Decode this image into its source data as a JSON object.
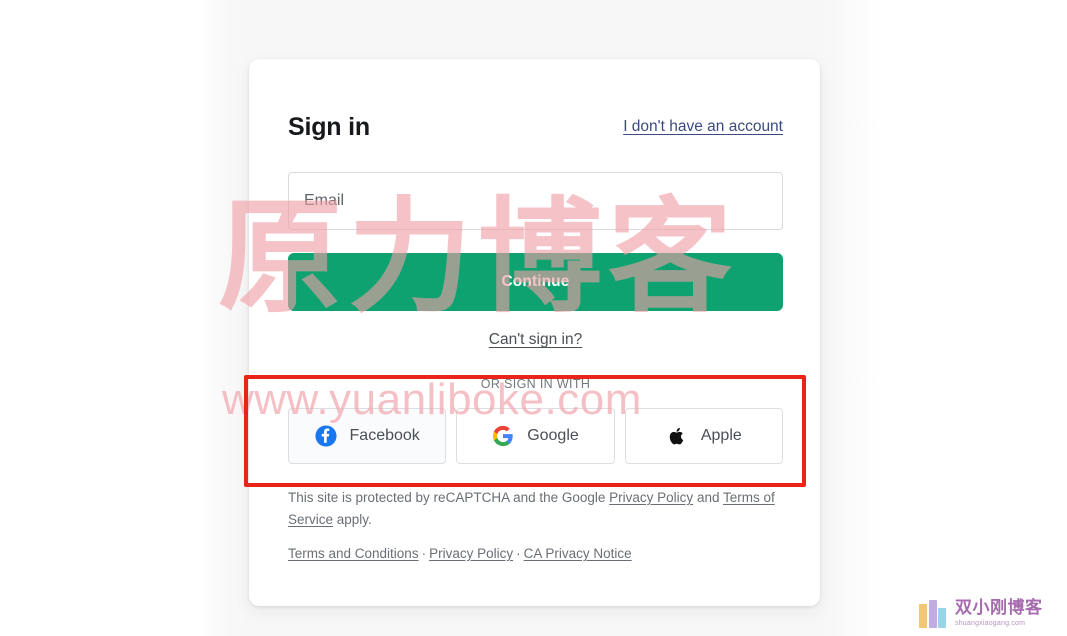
{
  "page": {
    "background_color": "#f7f7f8",
    "card_background": "#ffffff"
  },
  "card": {
    "title": "Sign in",
    "signup_link": "I don't have an account",
    "email_field": {
      "label": "Email",
      "value": "",
      "placeholder": "Email"
    },
    "continue_button": {
      "label": "Continue",
      "color": "#0ea271"
    },
    "cant_sign_in_link": "Can't sign in?",
    "divider_label": "OR SIGN IN WITH",
    "social_buttons": [
      {
        "label": "Facebook",
        "icon": "facebook-icon",
        "color": "#1877f2"
      },
      {
        "label": "Google",
        "icon": "google-icon",
        "color": "#4285f4"
      },
      {
        "label": "Apple",
        "icon": "apple-icon",
        "color": "#111111"
      }
    ],
    "legal": {
      "prefix": "This site is protected by reCAPTCHA and the Google ",
      "privacy_policy": "Privacy Policy",
      "middle": " and ",
      "terms_of_service": "Terms of Service",
      "suffix": " apply."
    },
    "footer_links": {
      "terms_and_conditions": "Terms and Conditions",
      "privacy_policy": "Privacy Policy",
      "ca_privacy_notice": "CA Privacy Notice",
      "separator": "·"
    }
  },
  "annotation": {
    "highlight_color": "#e8241b",
    "highlight_target": "social-sign-in-row"
  },
  "watermarks": {
    "chinese_text": "原力博客",
    "url_text": "www.yuanliboke.com",
    "color": "#f0a0a6",
    "brand": {
      "name": "双小刚博客",
      "url": "shuangxiaogang.com"
    }
  }
}
